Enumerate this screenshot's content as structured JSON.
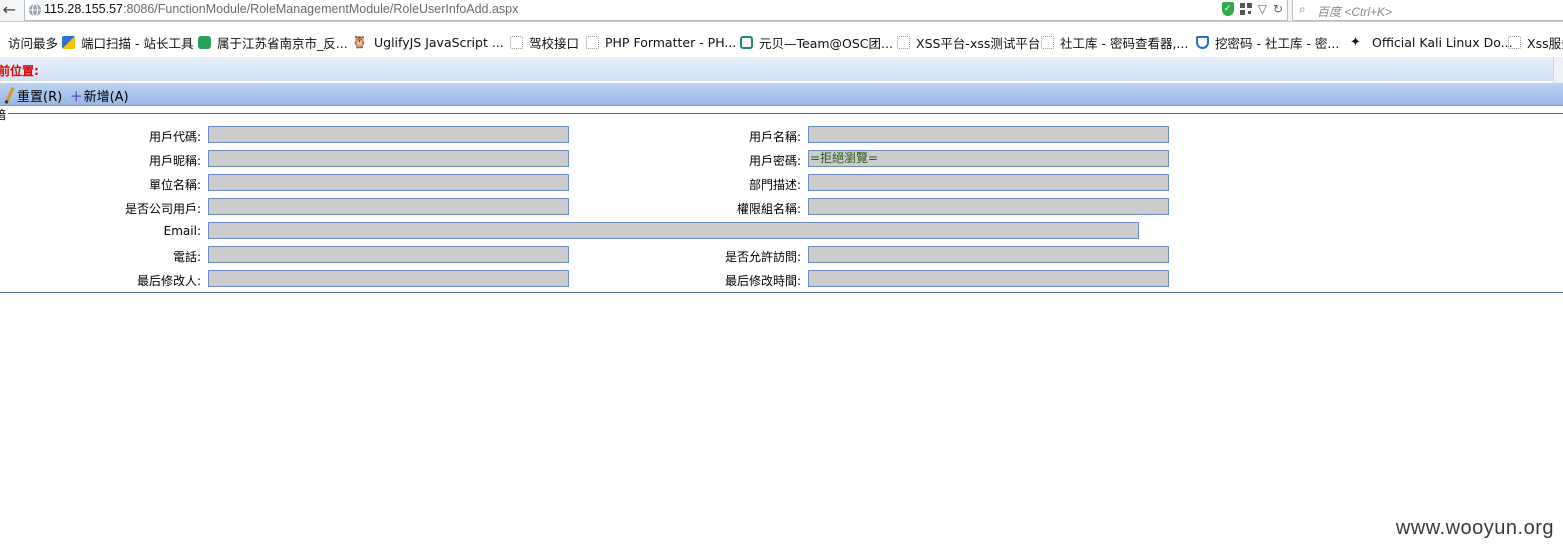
{
  "browser": {
    "url_host": "115.28.155.57",
    "url_path": ":8086/FunctionModule/RoleManagementModule/RoleUserInfoAdd.aspx",
    "search_placeholder": "百度 <Ctrl+K>"
  },
  "bookmarks": [
    {
      "label": "访问最多",
      "icon": "bookmark-icon"
    },
    {
      "label": "端口扫描 - 站长工具",
      "icon": "chinaz-icon"
    },
    {
      "label": "属于江苏省南京市_反...",
      "icon": "recycle-icon"
    },
    {
      "label": "UglifyJS JavaScript ...",
      "icon": "owl-icon"
    },
    {
      "label": "驾校接口",
      "icon": "page-icon"
    },
    {
      "label": "PHP Formatter - PH...",
      "icon": "page-icon"
    },
    {
      "label": "元贝—Team@OSC团...",
      "icon": "osc-icon"
    },
    {
      "label": "XSS平台-xss测试平台",
      "icon": "page-icon"
    },
    {
      "label": "社工库 - 密码查看器,...",
      "icon": "page-icon"
    },
    {
      "label": "挖密码 - 社工库 - 密...",
      "icon": "shield-icon"
    },
    {
      "label": "Official Kali Linux Do...",
      "icon": "dragon-icon"
    },
    {
      "label": "Xss服务",
      "icon": "page-icon"
    }
  ],
  "page": {
    "location_label": "前位置:",
    "legend": "暗",
    "toolbar": {
      "reset_label": "重置(R)",
      "add_label": "新增(A)"
    },
    "form": {
      "user_code": {
        "label": "用戶代碼:",
        "value": ""
      },
      "user_name": {
        "label": "用戶名稱:",
        "value": ""
      },
      "nickname": {
        "label": "用戶昵稱:",
        "value": ""
      },
      "password": {
        "label": "用戶密碼:",
        "value": "=拒絕瀏覽="
      },
      "unit_name": {
        "label": "單位名稱:",
        "value": ""
      },
      "dept_desc": {
        "label": "部門描述:",
        "value": ""
      },
      "is_company_user": {
        "label": "是否公司用戶:",
        "value": ""
      },
      "permission_group": {
        "label": "權限組名稱:",
        "value": ""
      },
      "email": {
        "label": "Email:",
        "value": ""
      },
      "phone": {
        "label": "電話:",
        "value": ""
      },
      "allow_access": {
        "label": "是否允許訪問:",
        "value": ""
      },
      "modified_by": {
        "label": "最后修改人:",
        "value": ""
      },
      "modified_time": {
        "label": "最后修改時間:",
        "value": ""
      }
    }
  },
  "watermark": "www.wooyun.org"
}
